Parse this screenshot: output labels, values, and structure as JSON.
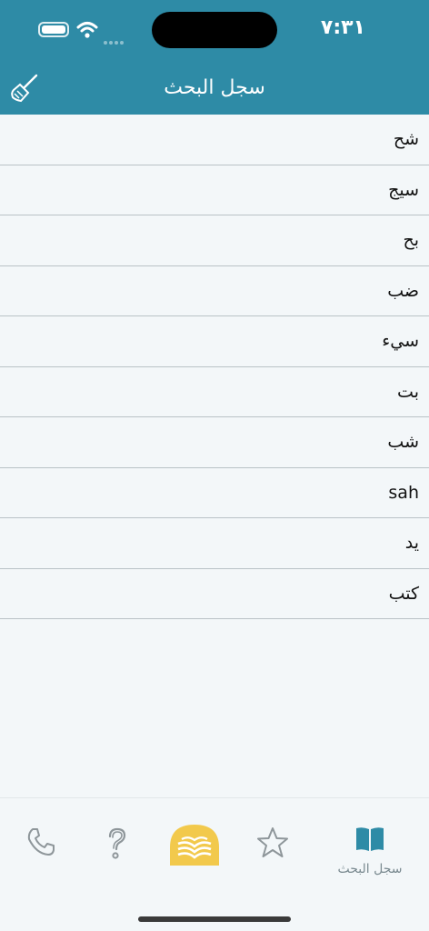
{
  "status": {
    "time": "٧:٣١"
  },
  "header": {
    "title": "سجل البحث",
    "clear_icon": "broom-icon"
  },
  "history": [
    "شح",
    "سيج",
    "بح",
    "ضب",
    "سيء",
    "بت",
    "شب",
    "sah",
    "يد",
    "كتب"
  ],
  "tabs": [
    {
      "icon": "phone-icon"
    },
    {
      "icon": "question-icon"
    },
    {
      "icon": "open-book-icon"
    },
    {
      "icon": "star-icon"
    },
    {
      "icon": "book-icon",
      "label": "سجل البحث"
    }
  ],
  "colors": {
    "accent": "#2e8ba6",
    "logo": "#f2c94c",
    "active_tab": "#2e8ba6"
  }
}
